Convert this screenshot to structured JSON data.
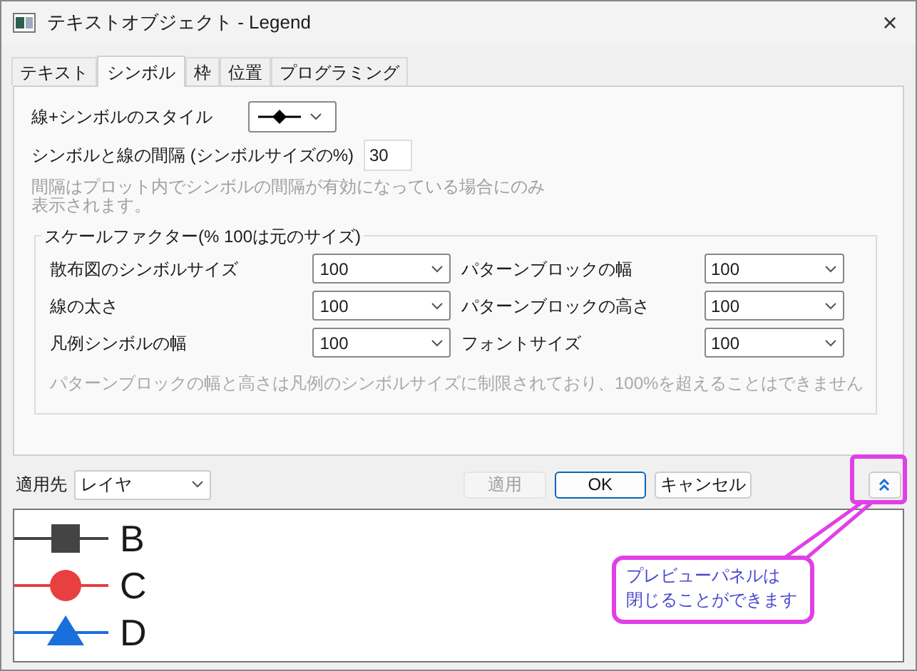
{
  "window": {
    "title": "テキストオブジェクト - Legend",
    "close": "×"
  },
  "tabs": [
    {
      "label": "テキスト",
      "selected": false
    },
    {
      "label": "シンボル",
      "selected": true
    },
    {
      "label": "枠",
      "selected": false
    },
    {
      "label": "位置",
      "selected": false
    },
    {
      "label": "プログラミング",
      "selected": false
    }
  ],
  "style_row": {
    "label": "線+シンボルのスタイル"
  },
  "gap_row": {
    "label": "シンボルと線の間隔 (シンボルサイズの%)",
    "value": "30"
  },
  "gap_note": "間隔はプロット内でシンボルの間隔が有効になっている場合にのみ表示されます。",
  "scale_group": {
    "title": "スケールファクター(% 100は元のサイズ)",
    "fields": [
      {
        "label": "散布図のシンボルサイズ",
        "value": "100"
      },
      {
        "label": "パターンブロックの幅",
        "value": "100"
      },
      {
        "label": "線の太さ",
        "value": "100"
      },
      {
        "label": "パターンブロックの高さ",
        "value": "100"
      },
      {
        "label": "凡例シンボルの幅",
        "value": "100"
      },
      {
        "label": "フォントサイズ",
        "value": "100"
      }
    ],
    "note": "パターンブロックの幅と高さは凡例のシンボルサイズに制限されており、100%を超えることはできません"
  },
  "apply_to": {
    "label": "適用先",
    "value": "レイヤ"
  },
  "buttons": [
    {
      "label": "適用",
      "disabled": true,
      "default": false
    },
    {
      "label": "OK",
      "disabled": false,
      "default": true
    },
    {
      "label": "キャンセル",
      "disabled": false,
      "default": false
    }
  ],
  "preview": {
    "items": [
      {
        "label": "B",
        "kind": "square",
        "color": "#444444"
      },
      {
        "label": "C",
        "kind": "circle",
        "color": "#e84040"
      },
      {
        "label": "D",
        "kind": "triangle",
        "color": "#1a6fdc"
      }
    ]
  },
  "callout": {
    "lines": [
      "プレビューパネルは",
      "閉じることができます"
    ]
  }
}
